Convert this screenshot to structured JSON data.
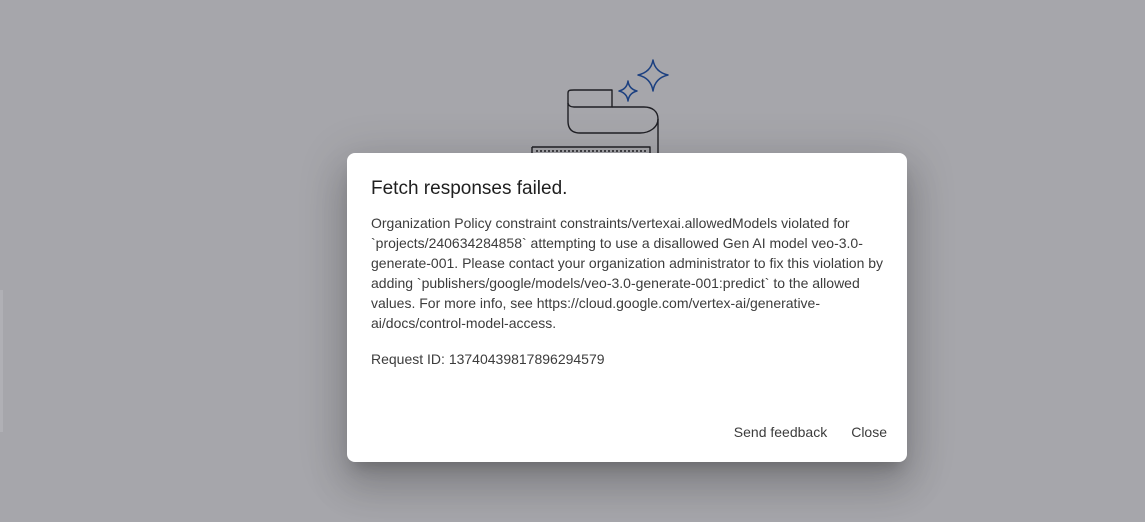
{
  "colors": {
    "scrim": "#a6a7ab",
    "dialog_background": "#ffffff",
    "illustration_stroke": "#1f1f1f",
    "sparkle_accent": "#1a56b8"
  },
  "dialog": {
    "title": "Fetch responses failed.",
    "message": "Organization Policy constraint constraints/vertexai.allowedModels violated for `projects/240634284858` attempting to use a disallowed Gen AI model veo-3.0-generate-001. Please contact your organization administrator to fix this violation by adding `publishers/google/models/veo-3.0-generate-001:predict` to the allowed values. For more info, see https://cloud.google.com/vertex-ai/generative-ai/docs/control-model-access.",
    "request_id": "Request ID: 13740439817896294579",
    "actions": {
      "send_feedback_label": "Send feedback",
      "close_label": "Close"
    }
  },
  "background": {
    "illustration_icon": "scroll-sparkle-icon"
  }
}
